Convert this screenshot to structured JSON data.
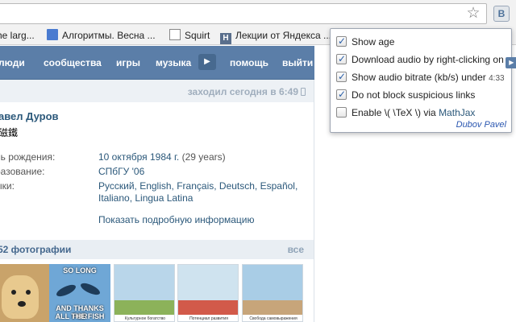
{
  "browser": {
    "star_icon": "star-icon",
    "extension_button_label": "B",
    "bookmarks": [
      {
        "label": "he larg..."
      },
      {
        "label": "Алгоритмы. Весна ..."
      },
      {
        "label": "Squirt"
      },
      {
        "label": "Лекции от Яндекса ..."
      }
    ]
  },
  "vk": {
    "nav": {
      "people": "люди",
      "communities": "сообщества",
      "games": "игры",
      "music": "музыка",
      "help": "помощь",
      "logout": "выйти"
    },
    "last_seen": "заходил сегодня в 6:49",
    "profile": {
      "name": "авел Дуров",
      "subname": "磁鐵",
      "birthday_label": "нь рождения:",
      "birthday_value": "10 октября 1984 г.",
      "birthday_age": "(29 years)",
      "education_label": "разование:",
      "education_value": "СПбГУ '06",
      "languages_label": "ыки:",
      "languages_line1": "Русский, English, Français, Deutsch, Español,",
      "languages_line2": "Italiano, Lingua Latina",
      "more_info": "Показать подробную информацию"
    },
    "photos": {
      "title": "52 фотографии",
      "all": "все",
      "meme_top": "SO LONG",
      "meme_bottom_1": "AND THANKS FOR",
      "meme_bottom_2": "ALL THE FISH",
      "poster_captions": [
        "Культурное богатство",
        "Потенциал развития",
        "Свобода самовыражения"
      ]
    }
  },
  "popup": {
    "options": [
      {
        "label": "Show age",
        "checked": true
      },
      {
        "label": "Download audio by right-clicking on",
        "checked": true
      },
      {
        "label": "Show audio bitrate (kb/s) under",
        "suffix": "4:33",
        "checked": true
      },
      {
        "label": "Do not block suspicious links",
        "checked": true
      },
      {
        "label": "Enable \\( \\TeX \\) via",
        "link": "MathJax",
        "checked": false
      }
    ],
    "author": "Dubov Pavel"
  },
  "colors": {
    "vk_header": "#5b7ea8",
    "vk_link": "#2b587a",
    "status_bar": "#edf1f5"
  }
}
